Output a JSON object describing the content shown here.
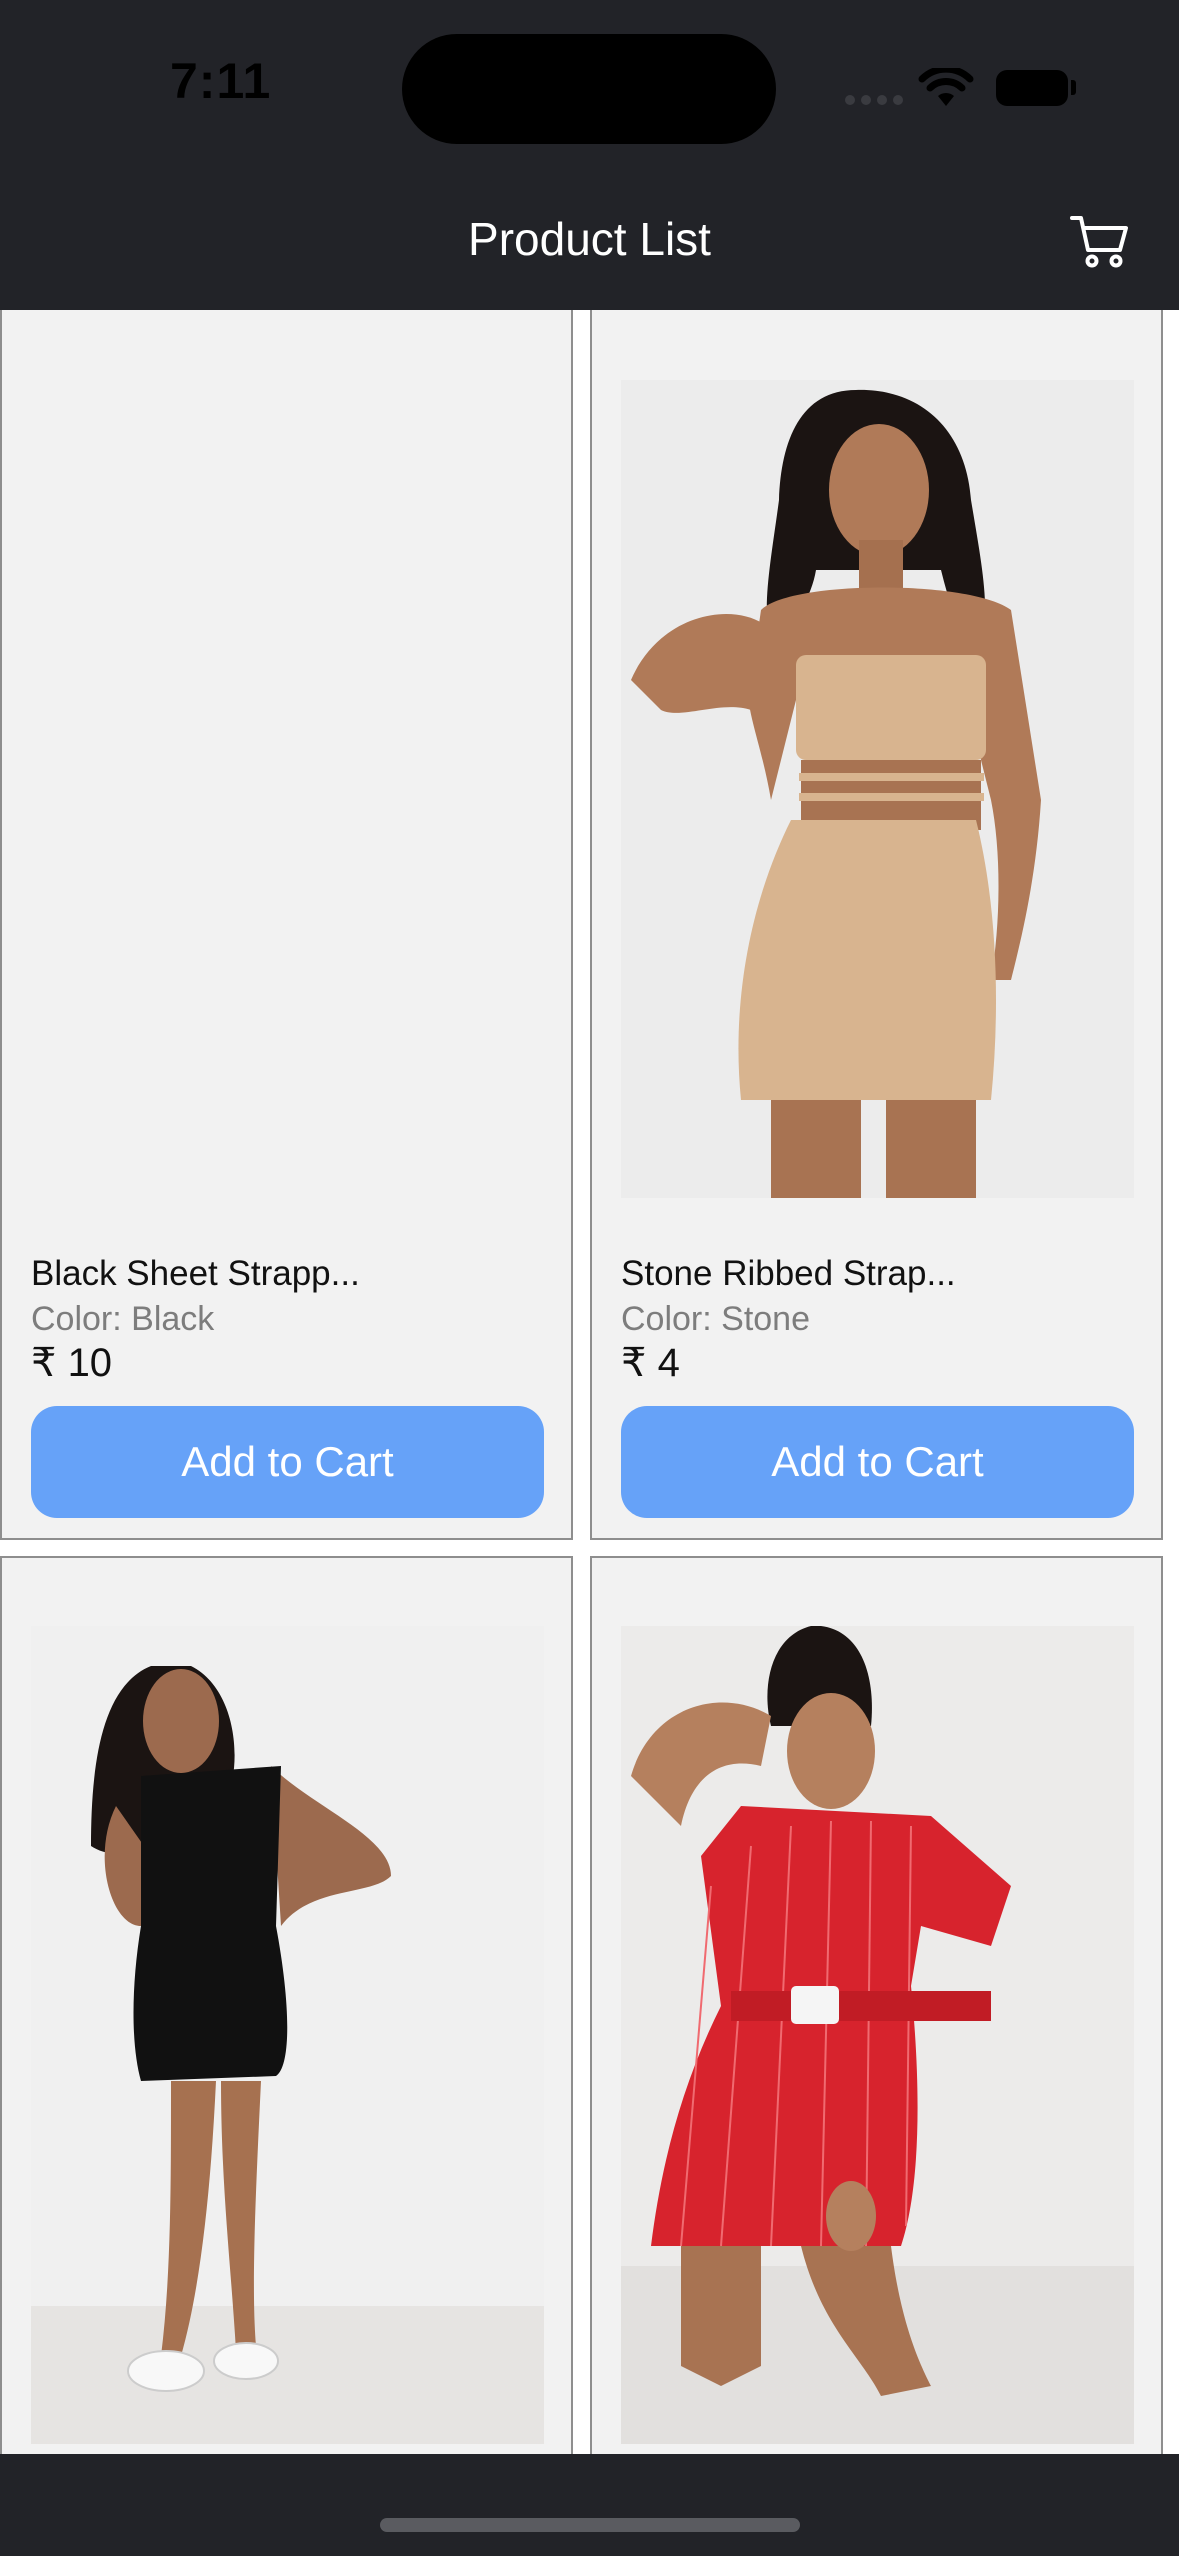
{
  "status_bar": {
    "time": "7:11"
  },
  "header": {
    "title": "Product List",
    "cart_icon": "cart-icon"
  },
  "products": [
    {
      "name": "Black Sheet Strapp...",
      "color": "Color: Black",
      "price": "₹ 10",
      "button": "Add to Cart"
    },
    {
      "name": "Stone Ribbed Strap...",
      "color": "Color: Stone",
      "price": "₹ 4",
      "button": "Add to Cart"
    },
    {
      "name": "",
      "color": "",
      "price": "",
      "button": ""
    },
    {
      "name": "",
      "color": "",
      "price": "",
      "button": ""
    }
  ],
  "colors": {
    "background": "#222328",
    "card": "#f2f2f2",
    "button": "#66a2f8"
  }
}
